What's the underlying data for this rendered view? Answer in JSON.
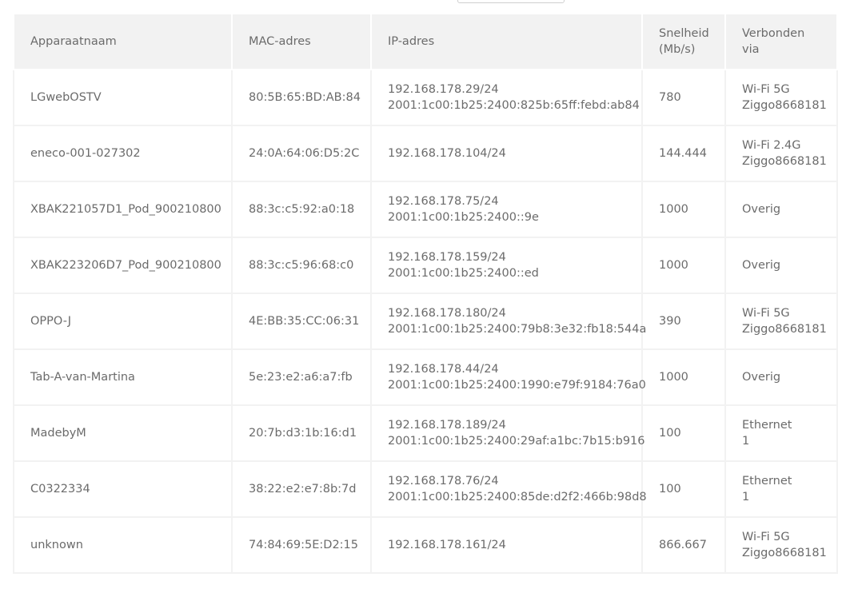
{
  "table": {
    "headers": {
      "name": "Apparaatnaam",
      "mac": "MAC-adres",
      "ip": "IP-adres",
      "speed_line1": "Snelheid",
      "speed_line2": "(Mb/s)",
      "via_line1": "Verbonden",
      "via_line2": "via"
    },
    "rows": [
      {
        "name": "LGwebOSTV",
        "mac": "80:5B:65:BD:AB:84",
        "ip1": "192.168.178.29/24",
        "ip2": "2001:1c00:1b25:2400:825b:65ff:febd:ab84",
        "speed": "780",
        "via1": "Wi-Fi 5G",
        "via2": "Ziggo8668181"
      },
      {
        "name": "eneco-001-027302",
        "mac": "24:0A:64:06:D5:2C",
        "ip1": "192.168.178.104/24",
        "ip2": "",
        "speed": "144.444",
        "via1": "Wi-Fi 2.4G",
        "via2": "Ziggo8668181"
      },
      {
        "name": "XBAK221057D1_Pod_900210800",
        "mac": "88:3c:c5:92:a0:18",
        "ip1": "192.168.178.75/24",
        "ip2": "2001:1c00:1b25:2400::9e",
        "speed": "1000",
        "via1": "Overig",
        "via2": ""
      },
      {
        "name": "XBAK223206D7_Pod_900210800",
        "mac": "88:3c:c5:96:68:c0",
        "ip1": "192.168.178.159/24",
        "ip2": "2001:1c00:1b25:2400::ed",
        "speed": "1000",
        "via1": "Overig",
        "via2": ""
      },
      {
        "name": "OPPO-J",
        "mac": "4E:BB:35:CC:06:31",
        "ip1": "192.168.178.180/24",
        "ip2": "2001:1c00:1b25:2400:79b8:3e32:fb18:544a",
        "speed": "390",
        "via1": "Wi-Fi 5G",
        "via2": "Ziggo8668181"
      },
      {
        "name": "Tab-A-van-Martina",
        "mac": "5e:23:e2:a6:a7:fb",
        "ip1": "192.168.178.44/24",
        "ip2": "2001:1c00:1b25:2400:1990:e79f:9184:76a0",
        "speed": "1000",
        "via1": "Overig",
        "via2": ""
      },
      {
        "name": "MadebyM",
        "mac": "20:7b:d3:1b:16:d1",
        "ip1": "192.168.178.189/24",
        "ip2": "2001:1c00:1b25:2400:29af:a1bc:7b15:b916",
        "speed": "100",
        "via1": "Ethernet",
        "via2": "1"
      },
      {
        "name": "C0322334",
        "mac": "38:22:e2:e7:8b:7d",
        "ip1": "192.168.178.76/24",
        "ip2": "2001:1c00:1b25:2400:85de:d2f2:466b:98d8",
        "speed": "100",
        "via1": "Ethernet",
        "via2": "1"
      },
      {
        "name": "unknown",
        "mac": "74:84:69:5E:D2:15",
        "ip1": "192.168.178.161/24",
        "ip2": "",
        "speed": "866.667",
        "via1": "Wi-Fi 5G",
        "via2": "Ziggo8668181"
      }
    ]
  }
}
